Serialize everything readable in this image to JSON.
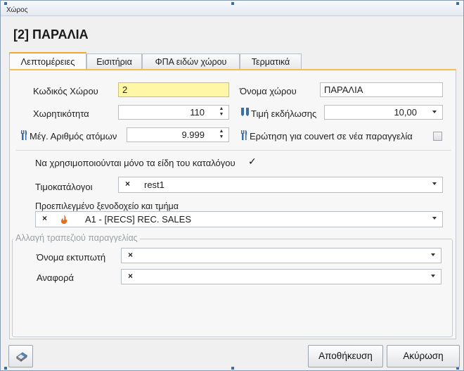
{
  "window": {
    "title": "Χώρος"
  },
  "header": {
    "title": "[2] ΠΑΡΑΛΙΑ"
  },
  "tabs": [
    {
      "label": "Λεπτομέρειες",
      "active": true
    },
    {
      "label": "Εισιτήρια",
      "active": false
    },
    {
      "label": "ΦΠΑ ειδών χώρου",
      "active": false
    },
    {
      "label": "Τερματικά",
      "active": false
    }
  ],
  "form": {
    "code_label": "Κωδικός Χώρου",
    "code_value": "2",
    "name_label": "Όνομα χώρου",
    "name_value": "ΠΑΡΑΛΙΑ",
    "capacity_label": "Χωρητικότητα",
    "capacity_value": "110",
    "event_price_label": "Τιμή εκδήλωσης",
    "event_price_value": "10,00",
    "max_people_label": "Μέγ. Αριθμός ατόμων",
    "max_people_value": "9.999",
    "couvert_label": "Ερώτηση για couvert σε νέα παραγγελία",
    "couvert_checked": false,
    "catalog_only_label": "Να χρησιμοποιούνται μόνο τα είδη του καταλόγου",
    "catalog_only_checked": true,
    "price_lists_label": "Τιμοκατάλογοι",
    "price_lists_value": "rest1",
    "hotel_label": "Προεπιλεγμένο ξενοδοχείο και τμήμα",
    "hotel_value": "A1 - [RECS] REC. SALES"
  },
  "table_change_group": {
    "legend": "Αλλαγή τραπεζιού παραγγελίας",
    "printer_label": "Όνομα εκτυπωτή",
    "printer_value": "",
    "report_label": "Αναφορά",
    "report_value": ""
  },
  "footer": {
    "save_label": "Αποθήκευση",
    "cancel_label": "Ακύρωση"
  },
  "colors": {
    "accent_tab": "#f0a830",
    "yellow_field": "#fff6a8",
    "icon_blue": "#3a6ea5",
    "hotel_icon": "#e07020"
  }
}
